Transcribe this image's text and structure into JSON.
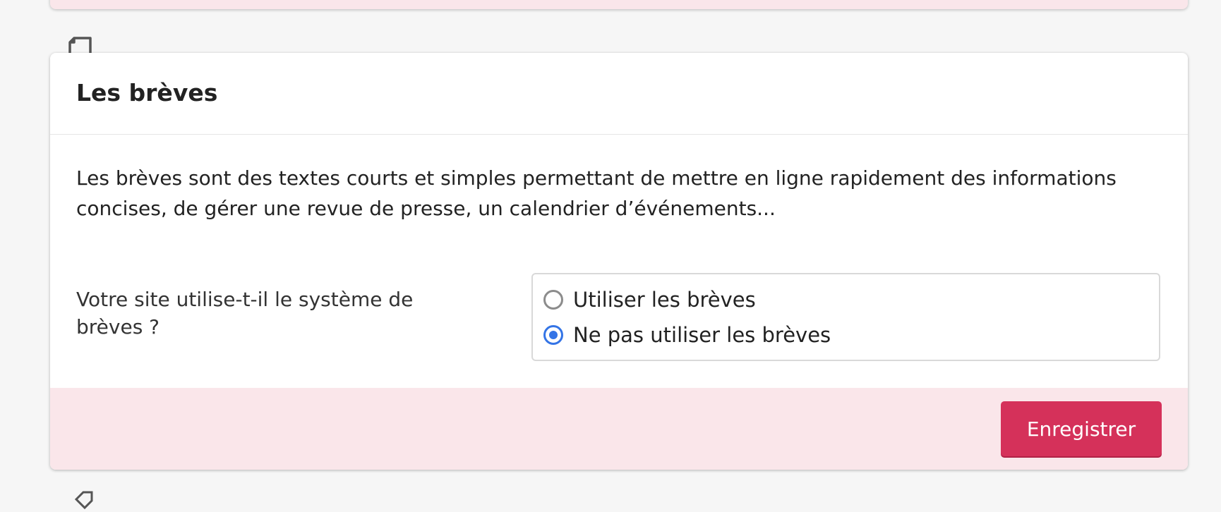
{
  "section": {
    "title": "Les brèves",
    "description": "Les brèves sont des textes courts et simples permettant de mettre en ligne rapidement des informations concises, de gérer une revue de presse, un calendrier d’événements...",
    "question": "Votre site utilise-t-il le système de brèves ?",
    "options": [
      {
        "label": "Utiliser les brèves",
        "checked": false
      },
      {
        "label": "Ne pas utiliser les brèves",
        "checked": true
      }
    ],
    "save_label": "Enregistrer"
  },
  "icons": {
    "section_icon": "page-corner-icon",
    "next_section_icon": "tag-icon"
  },
  "colors": {
    "accent_button": "#d5315a",
    "footer_bg": "#fae6ea",
    "radio_checked": "#3474e6"
  }
}
